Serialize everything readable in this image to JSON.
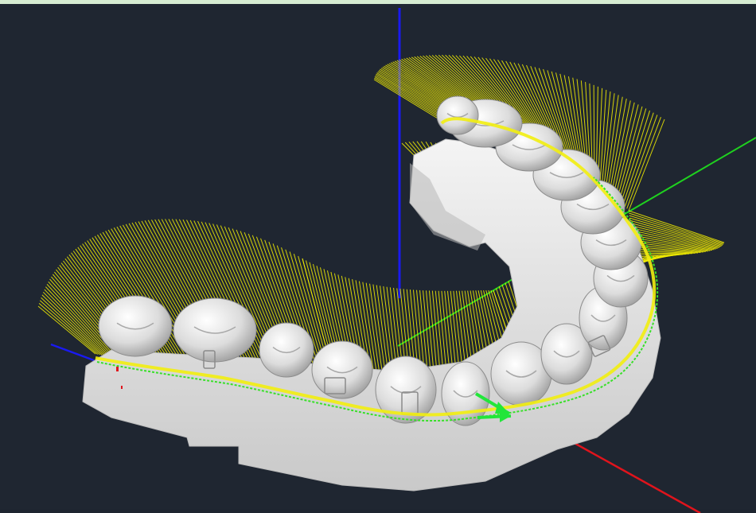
{
  "viewport": {
    "background": "#1f2631",
    "top_border_color": "#d6ecd2"
  },
  "axes": {
    "x_axis_color": "#e0141c",
    "y_axis_color": "#1fd11f",
    "z_axis_color": "#1a1af0"
  },
  "model": {
    "tooth_color": "#ebebeb",
    "shadow_color": "#9a9a9a",
    "gumline_color": "#38e028",
    "trim_line_color": "#f2ee10",
    "normal_line_color": "#f5f000",
    "arrow_color": "#22e63a"
  }
}
